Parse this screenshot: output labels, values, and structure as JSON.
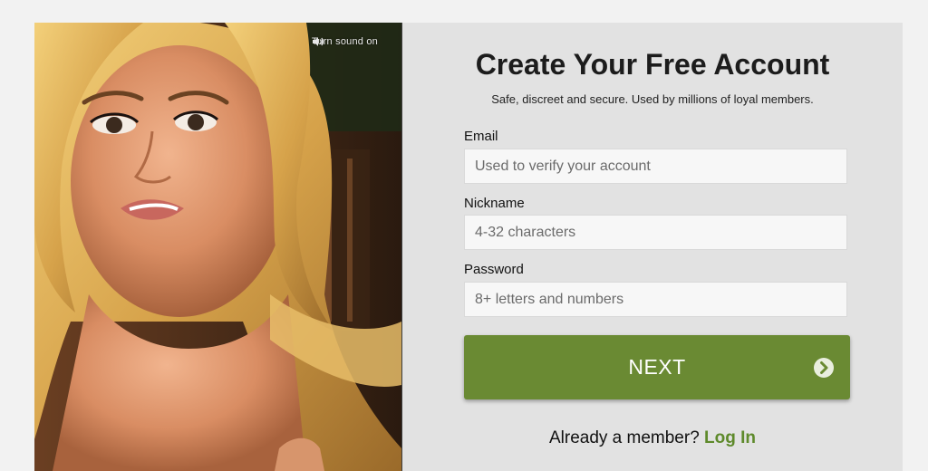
{
  "video": {
    "sound_toggle_label": "Turn sound on",
    "sound_icon": "speaker-icon"
  },
  "form": {
    "title": "Create Your Free Account",
    "subtitle": "Safe, discreet and secure. Used by millions of loyal members.",
    "email": {
      "label": "Email",
      "placeholder": "Used to verify your account",
      "value": ""
    },
    "nickname": {
      "label": "Nickname",
      "placeholder": "4-32 characters",
      "value": ""
    },
    "password": {
      "label": "Password",
      "placeholder": "8+ letters and numbers",
      "value": ""
    },
    "next_button": {
      "label": "NEXT",
      "icon": "chevron-right-circle-icon"
    },
    "login_prompt": "Already a member?",
    "login_link": "Log In"
  },
  "colors": {
    "accent_green": "#6a8a33",
    "link_green": "#5e8a2b",
    "panel_background": "#e2e2e2",
    "page_background": "#f2f2f2"
  }
}
